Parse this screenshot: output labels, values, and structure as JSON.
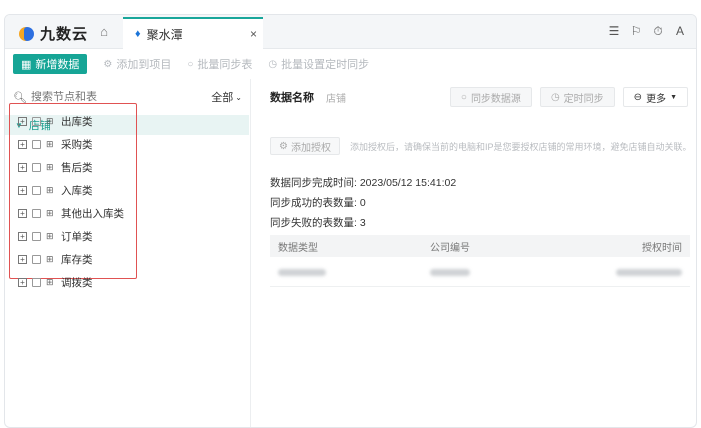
{
  "app": {
    "logo_text": "九数云",
    "tab_label": "聚水潭",
    "tab_close": "×"
  },
  "top_icons": [
    "☰",
    "⚐",
    "⏱",
    "A"
  ],
  "toolbar": {
    "new_data": "新增数据",
    "add_to_project": "添加到项目",
    "batch_sync_table": "批量同步表",
    "batch_schedule": "批量设置定时同步"
  },
  "left": {
    "search_placeholder": "搜索节点和表",
    "filter_all": "全部",
    "root_label": "店铺",
    "items": [
      {
        "label": "出库类"
      },
      {
        "label": "采购类"
      },
      {
        "label": "售后类"
      },
      {
        "label": "入库类"
      },
      {
        "label": "其他出入库类"
      },
      {
        "label": "订单类"
      },
      {
        "label": "库存类"
      },
      {
        "label": "调拨类"
      }
    ]
  },
  "right": {
    "title": "数据名称",
    "subtitle": "店铺",
    "sync_source": "同步数据源",
    "scheduled_sync": "定时同步",
    "more": "更多",
    "add_auth": "添加授权",
    "auth_tip": "添加授权后，请确保当前的电脑和IP是您要授权店铺的常用环境，避免店铺自动关联。",
    "sync_time_label": "数据同步完成时间: ",
    "sync_time_value": "2023/05/12 15:41:02",
    "success_label": "同步成功的表数量: ",
    "success_value": "0",
    "fail_label": "同步失败的表数量: ",
    "fail_value": "3",
    "table": {
      "headers": [
        "数据类型",
        "公司编号",
        "授权时间"
      ]
    }
  },
  "colors": {
    "accent": "#16a596",
    "highlight_border": "#e05252",
    "tab_dot": "#1b74d8"
  }
}
